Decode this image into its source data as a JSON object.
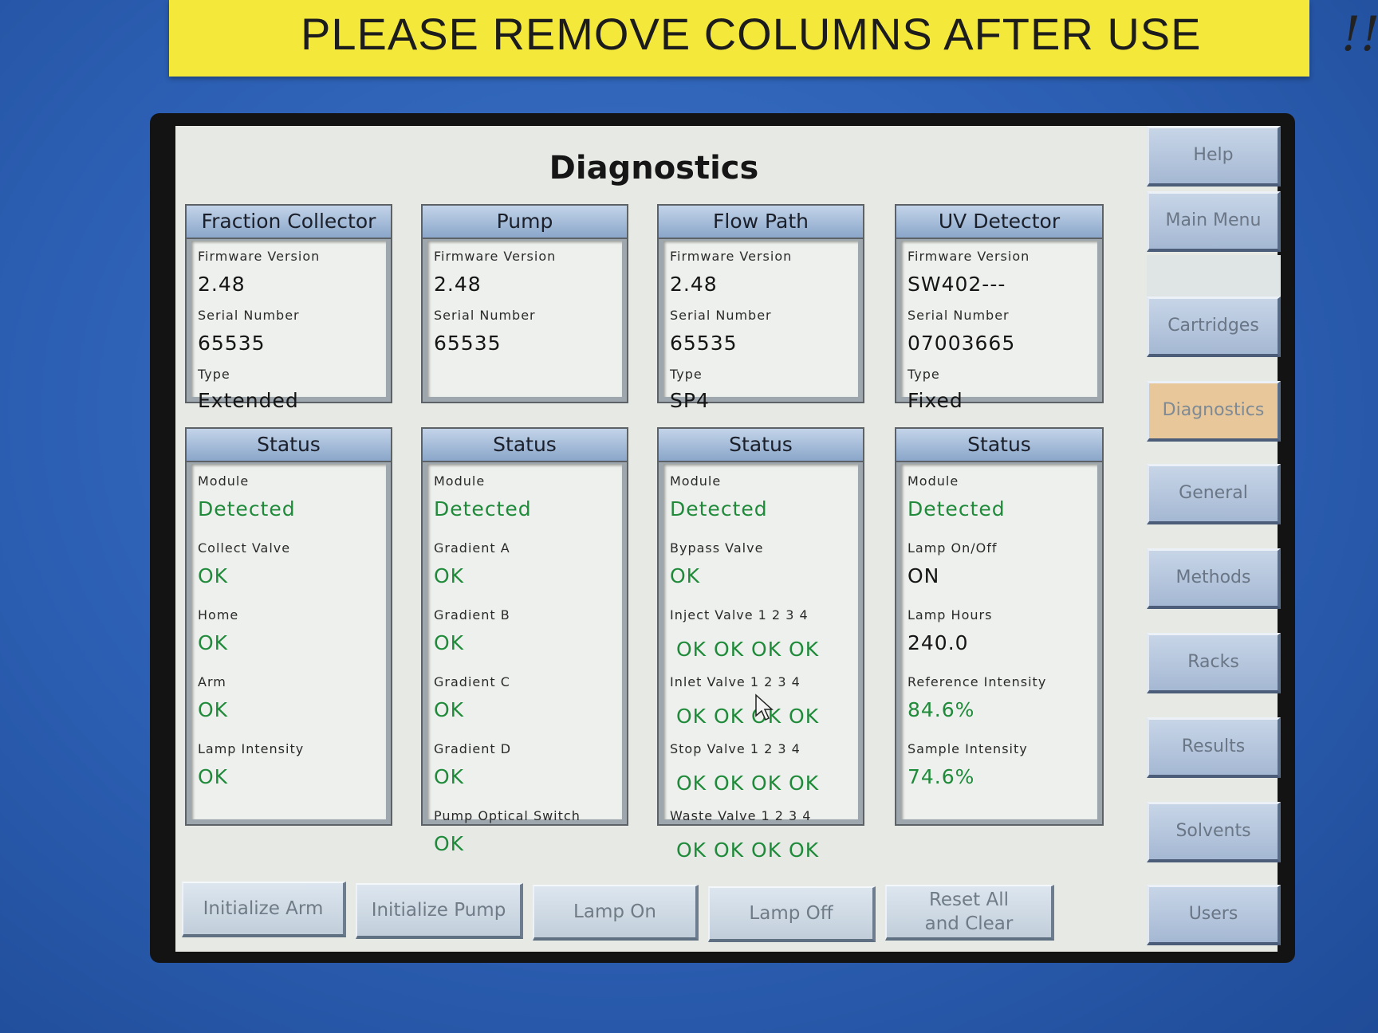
{
  "sticker": {
    "text": "PLEASE REMOVE COLUMNS AFTER USE",
    "scrawl": "!!!!!"
  },
  "page": {
    "title": "Diagnostics"
  },
  "info_panels": [
    {
      "title": "Fraction Collector",
      "firmware_label": "Firmware Version",
      "firmware": "2.48",
      "serial_label": "Serial Number",
      "serial": "65535",
      "type_label": "Type",
      "type": "Extended"
    },
    {
      "title": "Pump",
      "firmware_label": "Firmware Version",
      "firmware": "2.48",
      "serial_label": "Serial Number",
      "serial": "65535"
    },
    {
      "title": "Flow Path",
      "firmware_label": "Firmware Version",
      "firmware": "2.48",
      "serial_label": "Serial Number",
      "serial": "65535",
      "type_label": "Type",
      "type": "SP4"
    },
    {
      "title": "UV Detector",
      "firmware_label": "Firmware Version",
      "firmware": "SW402---",
      "serial_label": "Serial Number",
      "serial": "07003665",
      "type_label": "Type",
      "type": "Fixed"
    }
  ],
  "status_panels": [
    {
      "title": "Status",
      "items": [
        {
          "label": "Module",
          "value": "Detected"
        },
        {
          "label": "Collect Valve",
          "value": "OK"
        },
        {
          "label": "Home",
          "value": "OK"
        },
        {
          "label": "Arm",
          "value": "OK"
        },
        {
          "label": "Lamp Intensity",
          "value": "OK"
        }
      ]
    },
    {
      "title": "Status",
      "items": [
        {
          "label": "Module",
          "value": "Detected"
        },
        {
          "label": "Gradient A",
          "value": "OK"
        },
        {
          "label": "Gradient B",
          "value": "OK"
        },
        {
          "label": "Gradient C",
          "value": "OK"
        },
        {
          "label": "Gradient D",
          "value": "OK"
        },
        {
          "label": "Pump Optical Switch",
          "value": "OK"
        }
      ]
    },
    {
      "title": "Status",
      "items": [
        {
          "label": "Module",
          "value": "Detected"
        },
        {
          "label": "Bypass Valve",
          "value": "OK"
        },
        {
          "label": "Inject Valve 1 2 3 4",
          "value": "OK OK OK OK"
        },
        {
          "label": "Inlet Valve 1 2 3 4",
          "value": "OK OK OK OK"
        },
        {
          "label": "Stop Valve 1 2 3 4",
          "value": "OK OK OK OK"
        },
        {
          "label": "Waste Valve 1 2 3 4",
          "value": "OK OK OK OK"
        }
      ]
    },
    {
      "title": "Status",
      "items": [
        {
          "label": "Module",
          "value": "Detected"
        },
        {
          "label": "Lamp On/Off",
          "value": "ON"
        },
        {
          "label": "Lamp Hours",
          "value": "240.0"
        },
        {
          "label": "Reference Intensity",
          "value": "84.6%"
        },
        {
          "label": "Sample Intensity",
          "value": "74.6%"
        }
      ]
    }
  ],
  "sidebar": {
    "help": "Help",
    "main_menu": "Main Menu",
    "cartridges": "Cartridges",
    "diagnostics": "Diagnostics",
    "general": "General",
    "methods": "Methods",
    "racks": "Racks",
    "results": "Results",
    "solvents": "Solvents",
    "users": "Users"
  },
  "buttons": {
    "initialize_arm": "Initialize Arm",
    "initialize_pump": "Initialize Pump",
    "lamp_on": "Lamp On",
    "lamp_off": "Lamp Off",
    "reset_line1": "Reset All",
    "reset_line2": "and Clear"
  },
  "colors": {
    "ok_green": "#1f8a3a",
    "active_tab": "#e8c79a",
    "bezel_blue": "#2f64b8",
    "sticker_yellow": "#f4e93b"
  },
  "icons": {
    "cursor": "pointer-cursor-icon"
  }
}
